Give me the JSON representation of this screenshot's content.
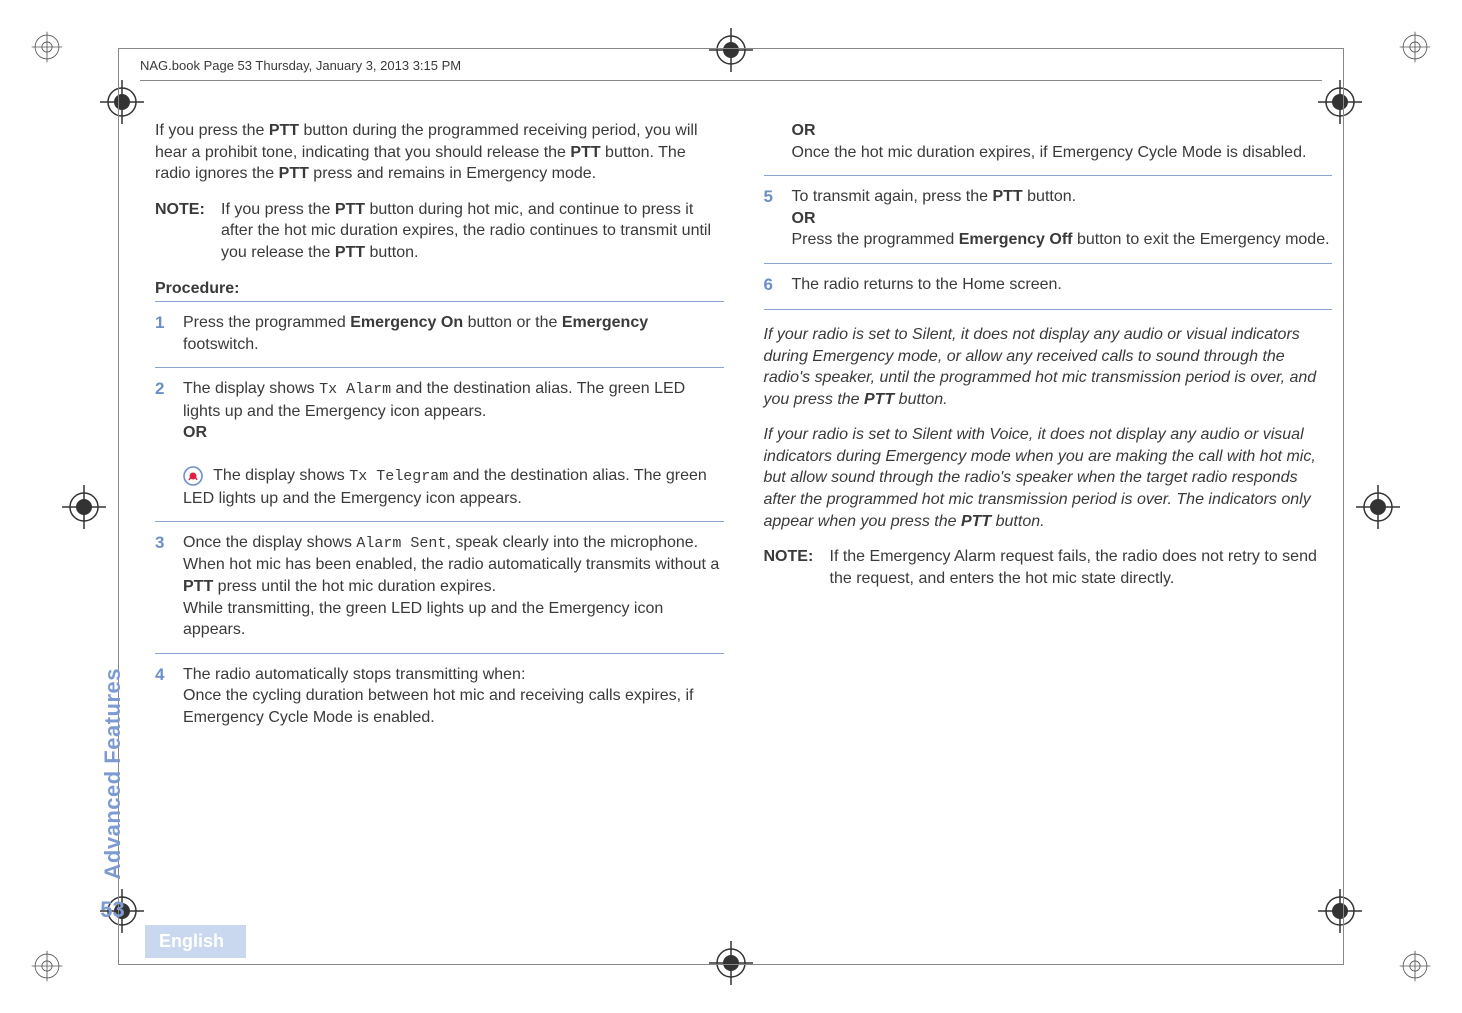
{
  "header": {
    "running_head": "NAG.book  Page 53  Thursday, January 3, 2013  3:15 PM"
  },
  "sidebar": {
    "section_label": "Advanced Features",
    "page_number": "53",
    "language_tag": "English"
  },
  "left": {
    "intro": "If you press the PTT button during the programmed receiving period, you will hear a prohibit tone, indicating that you should release the PTT button. The radio ignores the PTT press and remains in Emergency mode.",
    "note_label": "NOTE:",
    "note_body": "If you press the PTT button during hot mic, and continue to press it after the hot mic duration expires, the radio continues to transmit until you release the PTT button.",
    "procedure_head": "Procedure:",
    "s1": "Press the programmed Emergency On button or the Emergency footswitch.",
    "s2a_pre": "The display shows ",
    "s2a_mono": "Tx Alarm",
    "s2a_post": " and the destination alias. The green LED lights up and the Emergency icon appears.",
    "or": "OR",
    "s2b_pre": " The display shows ",
    "s2b_mono": "Tx Telegram",
    "s2b_post": " and the destination alias. The green LED lights up and the Emergency icon appears.",
    "s3_pre": "Once the display shows ",
    "s3_mono": "Alarm Sent",
    "s3_post": ", speak clearly into the microphone. When hot mic has been enabled, the radio automatically transmits without a PTT press until the hot mic duration expires.",
    "s3_l2": "While transmitting, the green LED lights up and the Emergency icon appears.",
    "s4_l1": "The radio automatically stops transmitting when:",
    "s4_l2": "Once the cycling duration between hot mic and receiving calls expires, if Emergency Cycle Mode is enabled."
  },
  "right": {
    "s4_cont_or": "OR",
    "s4_cont": "Once the hot mic duration expires, if Emergency Cycle Mode is disabled.",
    "s5_l1": "To transmit again, press the PTT button.",
    "s5_or": "OR",
    "s5_l2": "Press the programmed Emergency Off button to exit the Emergency mode.",
    "s6": "The radio returns to the Home screen.",
    "para1": "If your radio is set to Silent, it does not display any audio or visual indicators during Emergency mode, or allow any received calls to sound through the radio's speaker, until the programmed hot mic transmission period is over, and you press the PTT button.",
    "para2": "If your radio is set to Silent with Voice, it does not display any audio or visual indicators during Emergency mode when you are making the call with hot mic, but allow sound through the radio's speaker when the target radio responds after the programmed hot mic transmission period is over. The indicators only appear when you press the PTT button.",
    "note2_label": "NOTE:",
    "note2_body": "If the Emergency Alarm request fails, the radio does not retry to send the request, and enters the hot mic state directly."
  }
}
